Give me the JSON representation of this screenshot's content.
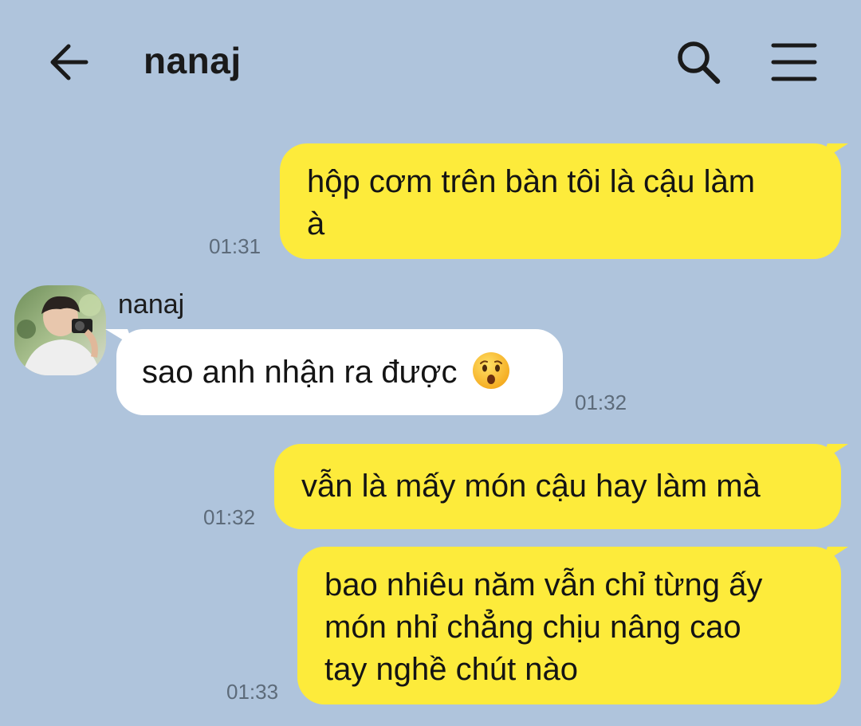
{
  "header": {
    "title": "nanaj",
    "back_icon": "arrow-left-icon",
    "search_icon": "search-icon",
    "menu_icon": "hamburger-menu-icon"
  },
  "colors": {
    "background": "#afc4dc",
    "outgoing_bubble": "#fdeb3b",
    "incoming_bubble": "#ffffff",
    "timestamp": "#5d6b7a"
  },
  "messages": [
    {
      "direction": "outgoing",
      "lines": [
        "hộp cơm trên bàn tôi là cậu làm",
        "à"
      ],
      "time": "01:31"
    },
    {
      "direction": "incoming",
      "sender": "nanaj",
      "text": "sao anh nhận ra được",
      "emoji": "hushed-face-emoji",
      "time": "01:32"
    },
    {
      "direction": "outgoing",
      "lines": [
        "vẫn là mấy món cậu hay làm mà"
      ],
      "time": "01:32"
    },
    {
      "direction": "outgoing",
      "lines": [
        "bao nhiêu năm vẫn chỉ từng ấy",
        "món nhỉ chẳng chịu nâng cao",
        "tay nghề chút nào"
      ],
      "time": "01:33"
    }
  ]
}
